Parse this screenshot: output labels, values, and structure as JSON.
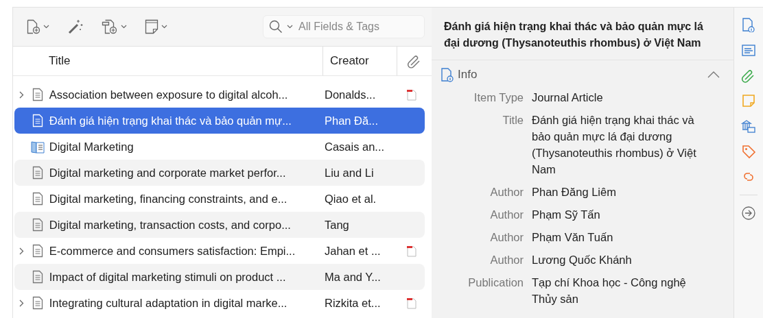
{
  "toolbar": {
    "search": {
      "placeholder": "All Fields & Tags"
    }
  },
  "table": {
    "columns": [
      "Title",
      "Creator"
    ],
    "rows": [
      {
        "title": "Association between exposure to digital alcoh...",
        "creator": "Donalds...",
        "kind": "article",
        "has_children": true,
        "has_pdf": true,
        "selected": false
      },
      {
        "title": "Đánh giá hiện trạng khai thác và bảo quản mự...",
        "creator": "Phan Đă...",
        "kind": "article",
        "has_children": false,
        "has_pdf": false,
        "selected": true
      },
      {
        "title": "Digital Marketing",
        "creator": "Casais an...",
        "kind": "book",
        "has_children": false,
        "has_pdf": false,
        "selected": false
      },
      {
        "title": "Digital marketing and corporate market perfor...",
        "creator": "Liu and Li",
        "kind": "article",
        "has_children": false,
        "has_pdf": false,
        "selected": false
      },
      {
        "title": "Digital marketing, financing constraints, and e...",
        "creator": "Qiao et al.",
        "kind": "article",
        "has_children": false,
        "has_pdf": false,
        "selected": false
      },
      {
        "title": "Digital marketing, transaction costs, and corpo...",
        "creator": "Tang",
        "kind": "article",
        "has_children": false,
        "has_pdf": false,
        "selected": false
      },
      {
        "title": "E-commerce and consumers satisfaction: Empi...",
        "creator": "Jahan et ...",
        "kind": "article",
        "has_children": true,
        "has_pdf": true,
        "selected": false
      },
      {
        "title": "Impact of digital marketing stimuli on product ...",
        "creator": "Ma and Y...",
        "kind": "article",
        "has_children": false,
        "has_pdf": false,
        "selected": false
      },
      {
        "title": "Integrating cultural adaptation in digital marke...",
        "creator": "Rizkita et...",
        "kind": "article",
        "has_children": true,
        "has_pdf": true,
        "selected": false
      }
    ]
  },
  "item_pane": {
    "title": "Đánh giá hiện trạng khai thác và bảo quản mực lá đại dương (Thysanoteuthis rhombus) ở Việt Nam",
    "section": {
      "heading": "Info",
      "expanded": true,
      "fields": [
        {
          "label": "Item Type",
          "value": "Journal Article"
        },
        {
          "label": "Title",
          "value": "Đánh giá hiện trạng khai thác và bảo quản mực lá đại dương (Thysanoteuthis rhombus) ở Việt Nam"
        },
        {
          "label": "Author",
          "value": "Phan Đăng Liêm"
        },
        {
          "label": "Author",
          "value": "Phạm Sỹ Tấn"
        },
        {
          "label": "Author",
          "value": "Phạm Văn Tuấn"
        },
        {
          "label": "Author",
          "value": "Lương Quốc Khánh"
        },
        {
          "label": "Publication",
          "value": "Tạp chí Khoa học - Công nghệ Thủy sản"
        }
      ]
    }
  }
}
